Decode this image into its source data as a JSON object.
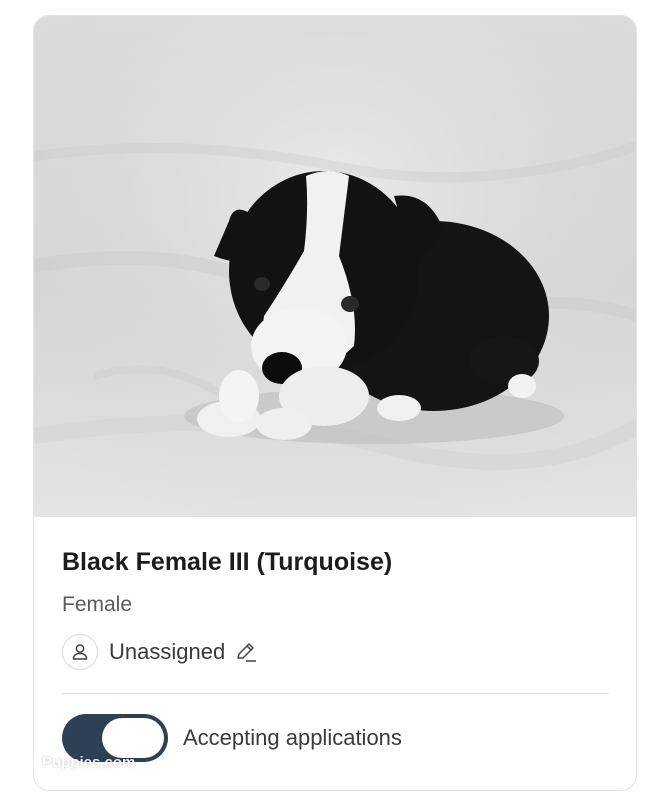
{
  "listing": {
    "title": "Black Female III (Turquoise)",
    "sex": "Female",
    "assignee": "Unassigned",
    "accepting_label": "Accepting applications",
    "accepting_applications": true
  },
  "photo": {
    "subject": "black and white puppy on light gray blanket"
  },
  "watermark": {
    "text": "Puppies.com"
  },
  "colors": {
    "toggle_on": "#2e4054",
    "title": "#1c1c1c",
    "muted_text": "#5a5a5a",
    "divider": "#e2e2e2"
  },
  "icons": {
    "avatar": "user-icon",
    "edit": "pencil-icon"
  }
}
